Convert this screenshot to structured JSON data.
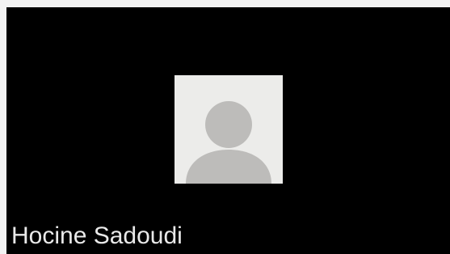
{
  "participant": {
    "name": "Hocine Sadoudi",
    "avatar_icon": "default-user-icon"
  },
  "colors": {
    "frame": "#f2f2f2",
    "tile_background": "#000000",
    "avatar_background": "#ececea",
    "avatar_silhouette": "#bdbcba",
    "name_text": "#e9e9e9"
  }
}
